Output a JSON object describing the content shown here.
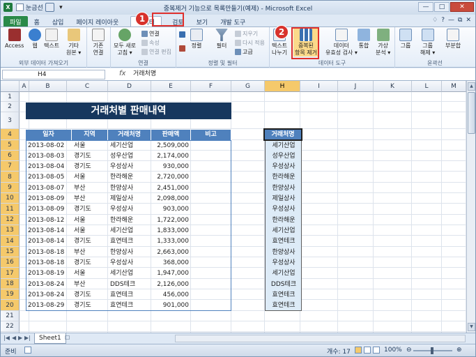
{
  "window": {
    "title": "중복제거 기능으로 목록만들기(예제) - Microsoft Excel"
  },
  "qat": {
    "label": "눈금선"
  },
  "tabs": [
    {
      "label": "파일"
    },
    {
      "label": "홈"
    },
    {
      "label": "삽입"
    },
    {
      "label": "페이지 레이아웃"
    },
    {
      "label": "데이터"
    },
    {
      "label": "검토"
    },
    {
      "label": "보기"
    },
    {
      "label": "개발 도구"
    }
  ],
  "ribbon": {
    "access": "Access",
    "web": "웹",
    "text": "텍스트",
    "other1": "기타",
    "other2": "원본 ▾",
    "existing1": "기존",
    "existing2": "연결",
    "refresh1": "모두 새로",
    "refresh2": "고침 ▾",
    "conn": "연결",
    "props": "속성",
    "editlinks": "연결 편집",
    "sort": "정렬",
    "filter": "필터",
    "clear": "지우기",
    "reapply": "다시 적용",
    "advanced": "고급",
    "t2c1": "텍스트",
    "t2c2": "나누기",
    "dup1": "중복된",
    "dup2": "항목 제거",
    "valid1": "데이터",
    "valid2": "유효성 검사 ▾",
    "consol": "통합",
    "whatif1": "가상",
    "whatif2": "분석 ▾",
    "group": "그룹",
    "ungroup1": "그룹",
    "ungroup2": "해제 ▾",
    "subtotal": "부분합",
    "g_external": "외부 데이터 가져오기",
    "g_conn": "연결",
    "g_sort": "정렬 및 필터",
    "g_tools": "데이터 도구",
    "g_outline": "윤곽선"
  },
  "callouts": {
    "one": "1",
    "two": "2"
  },
  "formula": {
    "namebox": "H4",
    "fx": "fx",
    "content": "거래처명"
  },
  "columns": [
    "A",
    "B",
    "C",
    "D",
    "E",
    "F",
    "G",
    "H",
    "I",
    "J",
    "K",
    "L",
    "M"
  ],
  "rows": [
    "1",
    "2",
    "3",
    "4",
    "5",
    "6",
    "7",
    "8",
    "9",
    "10",
    "11",
    "12",
    "13",
    "14",
    "15",
    "16",
    "17",
    "18",
    "19",
    "20",
    "21",
    "22",
    "23"
  ],
  "banner": "거래처별 판매내역",
  "table": {
    "headers": [
      "일자",
      "지역",
      "거래처명",
      "판매액",
      "비고"
    ],
    "rows": [
      [
        "2013-08-02",
        "서울",
        "세기산업",
        "2,509,000"
      ],
      [
        "2013-08-03",
        "경기도",
        "성우산업",
        "2,174,000"
      ],
      [
        "2013-08-04",
        "경기도",
        "우성상사",
        "930,000"
      ],
      [
        "2013-08-05",
        "서울",
        "한라해운",
        "2,720,000"
      ],
      [
        "2013-08-07",
        "부산",
        "한양상사",
        "2,451,000"
      ],
      [
        "2013-08-09",
        "부산",
        "제일상사",
        "2,098,000"
      ],
      [
        "2013-08-09",
        "경기도",
        "우성상사",
        "903,000"
      ],
      [
        "2013-08-12",
        "서울",
        "한라해운",
        "1,722,000"
      ],
      [
        "2013-08-14",
        "서울",
        "세기산업",
        "1,833,000"
      ],
      [
        "2013-08-14",
        "경기도",
        "효연테크",
        "1,333,000"
      ],
      [
        "2013-08-18",
        "부산",
        "한양상사",
        "2,663,000"
      ],
      [
        "2013-08-18",
        "경기도",
        "우성상사",
        "368,000"
      ],
      [
        "2013-08-19",
        "서울",
        "세기산업",
        "1,947,000"
      ],
      [
        "2013-08-24",
        "부산",
        "DDS테크",
        "2,126,000"
      ],
      [
        "2013-08-24",
        "경기도",
        "효연테크",
        "456,000"
      ],
      [
        "2013-08-29",
        "경기도",
        "효연테크",
        "901,000"
      ]
    ]
  },
  "hlist": {
    "header": "거래처명",
    "items": [
      "세기산업",
      "성우산업",
      "우성상사",
      "한라해운",
      "한양상사",
      "제일상사",
      "우성상사",
      "한라해운",
      "세기산업",
      "효연테크",
      "한양상사",
      "우성상사",
      "세기산업",
      "DDS테크",
      "효연테크",
      "효연테크"
    ]
  },
  "sheet": {
    "tab": "Sheet1"
  },
  "status": {
    "ready": "준비",
    "count": "개수: 17",
    "zoom": "100%"
  },
  "colors": {
    "banner": "#17375e",
    "header": "#4f81bd",
    "accent": "#d8322c"
  }
}
